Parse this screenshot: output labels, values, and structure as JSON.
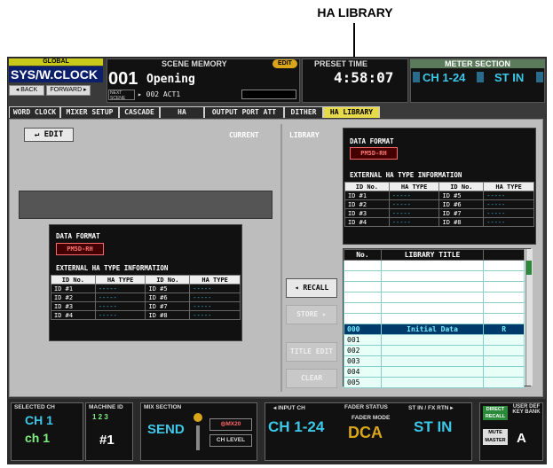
{
  "callout": {
    "label": "HA LIBRARY"
  },
  "header": {
    "global_label": "GLOBAL",
    "global_value": "SYS/W.CLOCK",
    "back_label": "◂ BACK",
    "forward_label": "FORWARD ▸",
    "scene_memory_label": "SCENE MEMORY",
    "edit_badge": "EDIT",
    "scene_number": "001",
    "scene_name": "Opening",
    "next_label": "NEXT SCENE",
    "next_scene": "▸ 002 ACT1",
    "preset_time_label": "PRESET TIME",
    "preset_time_value": "4:58:07",
    "meter_section_label": "METER SECTION",
    "meter_left": "CH 1-24",
    "meter_right": "ST IN"
  },
  "tabs": [
    {
      "label": "WORD CLOCK"
    },
    {
      "label": "MIXER SETUP"
    },
    {
      "label": "CASCADE"
    },
    {
      "label": "HA"
    },
    {
      "label": "OUTPUT PORT ATT"
    },
    {
      "label": "DITHER"
    },
    {
      "label": "HA LIBRARY"
    }
  ],
  "current": {
    "edit_button": "↵ EDIT",
    "section_label": "CURRENT",
    "data_format_label": "DATA FORMAT",
    "data_format_value": "PM5D-RH",
    "ext_label": "EXTERNAL HA TYPE INFORMATION",
    "col_id": "ID No.",
    "col_type": "HA TYPE",
    "rows": [
      {
        "id1": "ID #1",
        "t1": "-----",
        "id2": "ID #5",
        "t2": "-----"
      },
      {
        "id1": "ID #2",
        "t1": "-----",
        "id2": "ID #6",
        "t2": "-----"
      },
      {
        "id1": "ID #3",
        "t1": "-----",
        "id2": "ID #7",
        "t2": "-----"
      },
      {
        "id1": "ID #4",
        "t1": "-----",
        "id2": "ID #8",
        "t2": "-----"
      }
    ]
  },
  "library": {
    "section_label": "LIBRARY",
    "data_format_label": "DATA FORMAT",
    "data_format_value": "PM5D-RH",
    "ext_label": "EXTERNAL HA TYPE INFORMATION",
    "col_id": "ID No.",
    "col_type": "HA TYPE",
    "rows": [
      {
        "id1": "ID #1",
        "t1": "-----",
        "id2": "ID #5",
        "t2": "-----"
      },
      {
        "id1": "ID #2",
        "t1": "-----",
        "id2": "ID #6",
        "t2": "-----"
      },
      {
        "id1": "ID #3",
        "t1": "-----",
        "id2": "ID #7",
        "t2": "-----"
      },
      {
        "id1": "ID #4",
        "t1": "-----",
        "id2": "ID #8",
        "t2": "-----"
      }
    ],
    "recall_button": "◂ RECALL",
    "store_button": "STORE ▸",
    "title_edit_button": "TITLE EDIT",
    "clear_button": "CLEAR",
    "list_headers": {
      "no": "No.",
      "title": "LIBRARY TITLE",
      "flag": ""
    },
    "list_rows": [
      {
        "no": "",
        "title": "",
        "flag": "",
        "kind": "pl"
      },
      {
        "no": "",
        "title": "",
        "flag": "",
        "kind": "pl"
      },
      {
        "no": "",
        "title": "",
        "flag": "",
        "kind": "pl"
      },
      {
        "no": "",
        "title": "",
        "flag": "",
        "kind": "pl"
      },
      {
        "no": "",
        "title": "",
        "flag": "",
        "kind": "pl"
      },
      {
        "no": "",
        "title": "",
        "flag": "",
        "kind": "pl"
      },
      {
        "no": "000",
        "title": "Initial Data",
        "flag": "R",
        "kind": "sel"
      },
      {
        "no": "001",
        "title": "",
        "flag": "",
        "kind": ""
      },
      {
        "no": "002",
        "title": "",
        "flag": "",
        "kind": ""
      },
      {
        "no": "003",
        "title": "",
        "flag": "",
        "kind": ""
      },
      {
        "no": "004",
        "title": "",
        "flag": "",
        "kind": ""
      },
      {
        "no": "005",
        "title": "",
        "flag": "",
        "kind": ""
      }
    ]
  },
  "bottom": {
    "selected_ch_label": "SELECTED CH",
    "selected_ch_1": "CH 1",
    "selected_ch_2": "ch 1",
    "machine_id_label": "MACHINE ID",
    "machine_id_digits": "1 2 3",
    "machine_id_value": "#1",
    "mix_section_label": "MIX SECTION",
    "mix_section_value": "SEND",
    "mix_target": "◎MX20",
    "ch_level": "CH LEVEL",
    "input_ch_label": "◂ INPUT CH",
    "input_ch_value": "CH 1-24",
    "fader_status_label": "FADER STATUS",
    "fader_mode_label": "FADER MODE",
    "fader_mode_value": "DCA",
    "stin_label": "ST IN / FX RTN ▸",
    "stin_value": "ST IN",
    "direct_recall": "DIRECT RECALL",
    "mute_master": "MUTE MASTER",
    "user_def_label": "USER DEF KEY BANK",
    "user_def_value": "A"
  }
}
